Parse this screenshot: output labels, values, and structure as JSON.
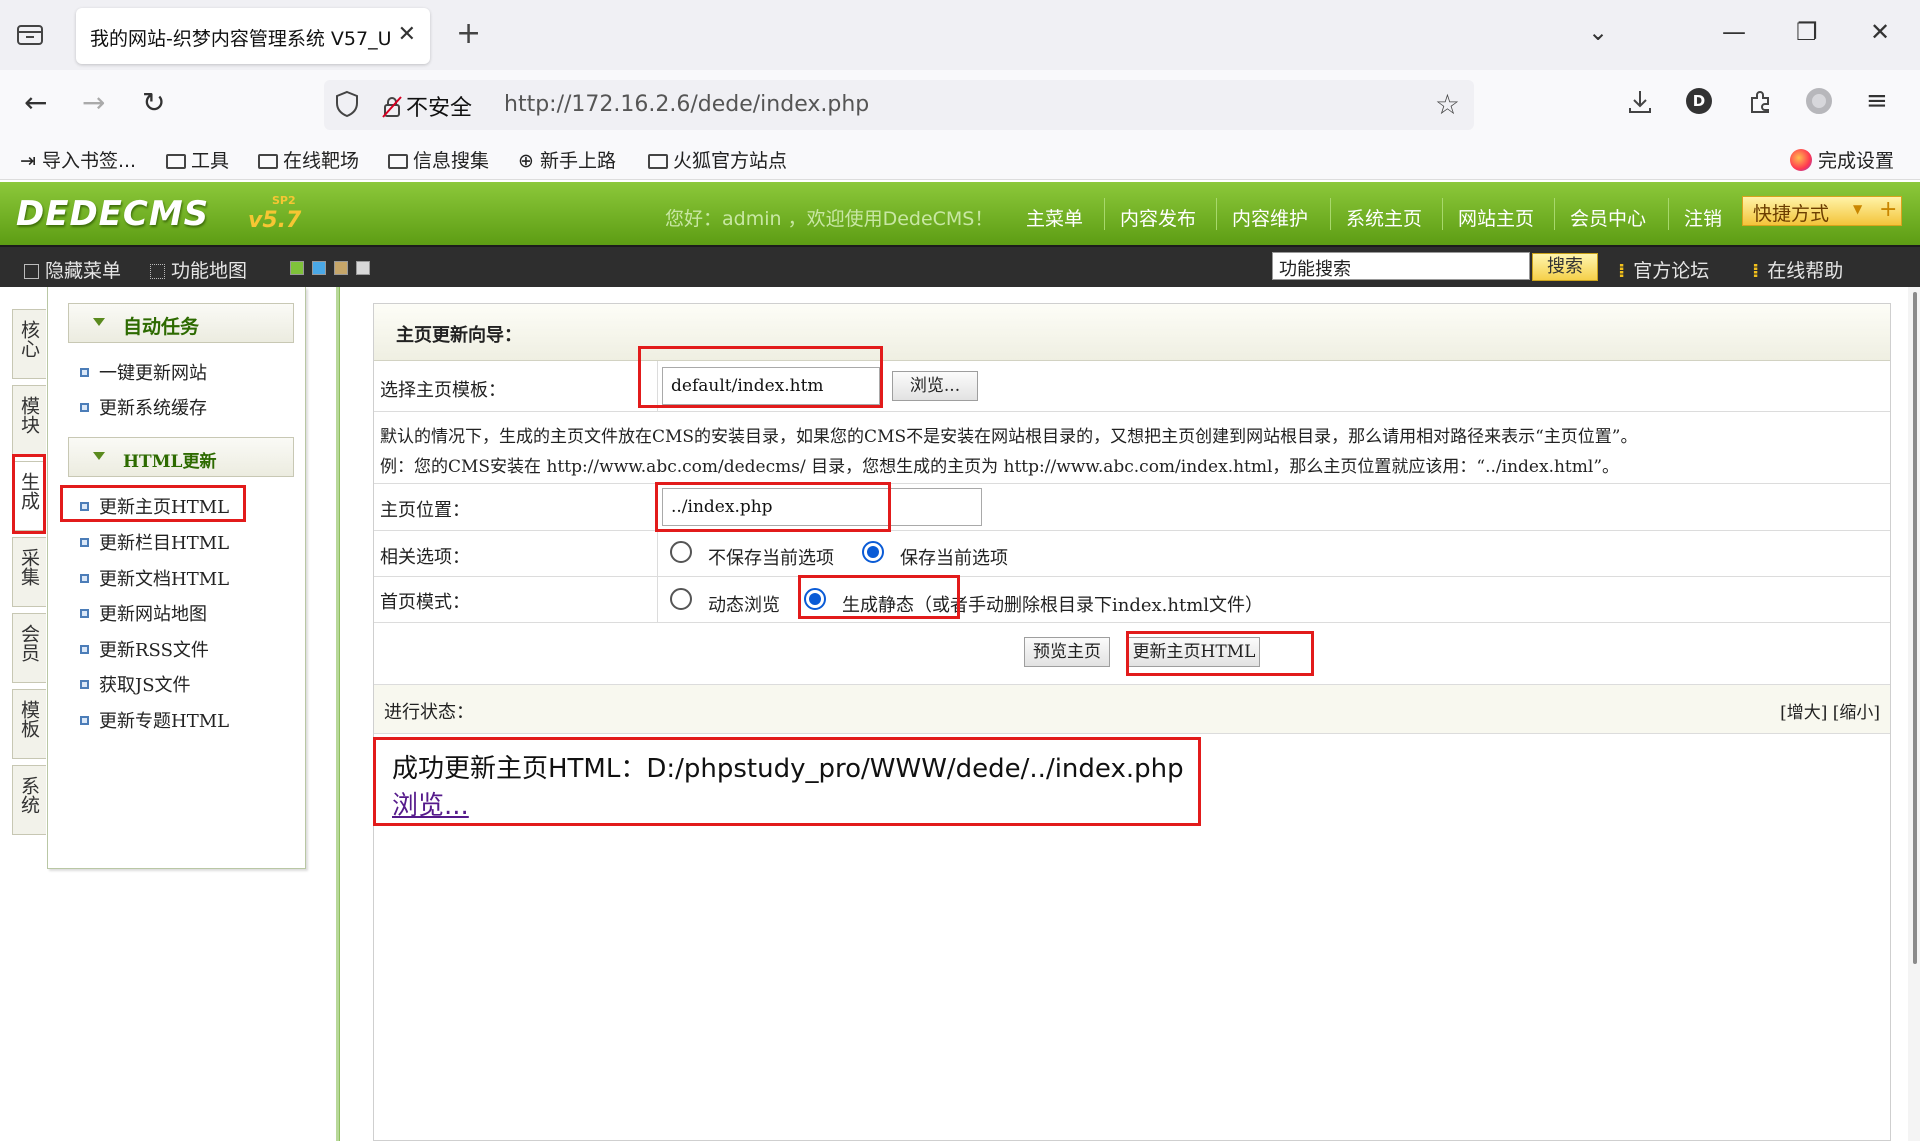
{
  "browser": {
    "tab_title": "我的网站-织梦内容管理系统 V57_U",
    "url_security": "不安全",
    "url_host": "http://172.16.2.6",
    "url_path": "/dede/index.php",
    "profile_initial": "D",
    "bookmarks": [
      "导入书签...",
      "工具",
      "在线靶场",
      "信息搜集",
      "新手上路",
      "火狐官方站点"
    ],
    "finish_setup": "完成设置"
  },
  "cms": {
    "logo": "DEDECMS",
    "version": "v5.7",
    "sp": "SP2",
    "welcome": "您好：admin ，欢迎使用DedeCMS！",
    "top_nav": [
      "主菜单",
      "内容发布",
      "内容维护",
      "系统主页",
      "网站主页",
      "会员中心",
      "注销"
    ],
    "quick_menu": "快捷方式",
    "hide_menu": "隐藏菜单",
    "func_map": "功能地图",
    "search_placeholder": "功能搜索",
    "search_button": "搜索",
    "forum": "官方论坛",
    "help": "在线帮助"
  },
  "vertical_tabs": [
    "核心",
    "模块",
    "生成",
    "采集",
    "会员",
    "模板",
    "系统"
  ],
  "left_menu": {
    "group1_title": "自动任务",
    "group1_items": [
      "一键更新网站",
      "更新系统缓存"
    ],
    "group2_title": "HTML更新",
    "group2_items": [
      "更新主页HTML",
      "更新栏目HTML",
      "更新文档HTML",
      "更新网站地图",
      "更新RSS文件",
      "获取JS文件",
      "更新专题HTML"
    ]
  },
  "form": {
    "title": "主页更新向导：",
    "template_label": "选择主页模板：",
    "template_value": "default/index.htm",
    "browse_button": "浏览...",
    "info_line1": "默认的情况下，生成的主页文件放在CMS的安装目录，如果您的CMS不是安装在网站根目录的，又想把主页创建到网站根目录，那么请用相对路径来表示“主页位置”。",
    "info_line2": "例：您的CMS安装在 http://www.abc.com/dedecms/ 目录，您想生成的主页为 http://www.abc.com/index.html，那么主页位置就应该用：“../index.html”。",
    "position_label": "主页位置：",
    "position_value": "../index.php",
    "options_label": "相关选项：",
    "option_no_save": "不保存当前选项",
    "option_save": "保存当前选项",
    "mode_label": "首页模式：",
    "mode_dynamic": "动态浏览",
    "mode_static": "生成静态（或者手动删除根目录下index.html文件）",
    "preview_button": "预览主页",
    "update_button": "更新主页HTML",
    "status_label": "进行状态：",
    "zoom_controls": "[增大] [缩小]",
    "success_message": "成功更新主页HTML：D:/phpstudy_pro/WWW/dede/../index.php",
    "success_link": "浏览..."
  },
  "colors": {
    "header_green": "#6fae22",
    "highlight_red": "#e21b1b",
    "radio_blue": "#0a5bd6"
  }
}
